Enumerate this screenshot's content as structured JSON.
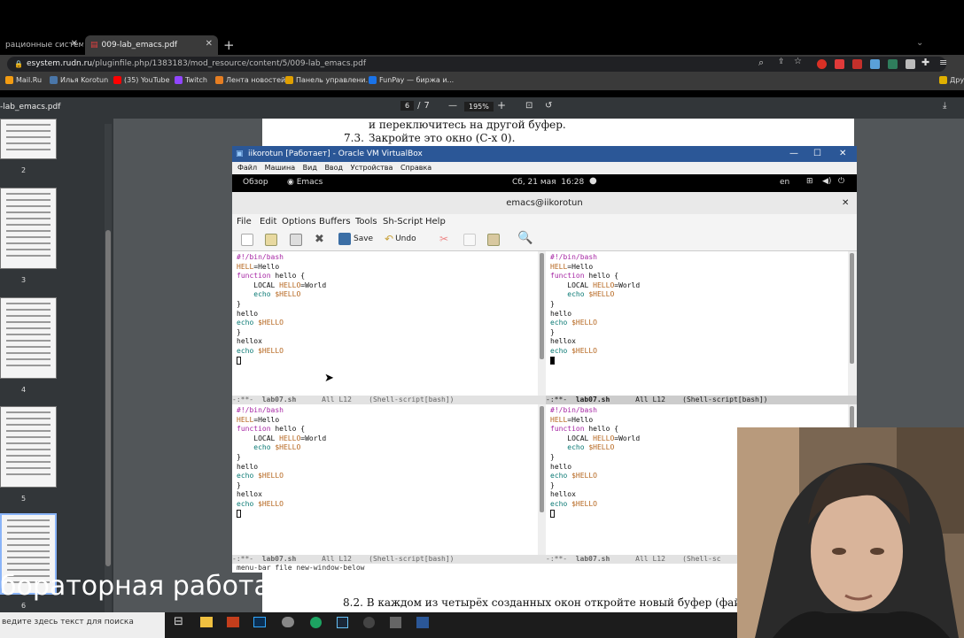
{
  "browser": {
    "tabs": [
      {
        "label": "рационные системы |"
      },
      {
        "label": "009-lab_emacs.pdf"
      }
    ],
    "url_host": "esystem.rudn.ru",
    "url_path": "/pluginfile.php/1383183/mod_resource/content/5/009-lab_emacs.pdf",
    "bookmarks": [
      "Mail.Ru",
      "Илья Korotun",
      "(35) YouTube",
      "Twitch",
      "Лента новостей",
      "Панель управлени...",
      "FunPay — биржа и...",
      "Дру"
    ]
  },
  "pdf": {
    "title": "-lab_emacs.pdf",
    "page_current": "6",
    "page_sep": "/",
    "page_total": "7",
    "zoom_out": "—",
    "zoom_in": "+",
    "zoom": "195%",
    "thumb_numbers": [
      "2",
      "3",
      "4",
      "5",
      "6"
    ],
    "text_top1": "и переключитесь на другой буфер.",
    "text_num1": "7.3.",
    "text_line1": "Закройте это окно (C-x 0).",
    "text_bottom": "8.2.  В каждом из четырёх созданных окон откройте новый буфер (файл) и"
  },
  "vm": {
    "title": "iikorotun [Работает] - Oracle VM VirtualBox",
    "menu": [
      "Файл",
      "Машина",
      "Вид",
      "Ввод",
      "Устройства",
      "Справка"
    ],
    "gnome_overview": "Обзор",
    "gnome_app": "Emacs",
    "gnome_clock": "Сб, 21 мая  16:28",
    "gnome_lang": "en"
  },
  "emacs": {
    "frame_title": "emacs@iikorotun",
    "menu": [
      "File",
      "Edit",
      "Options",
      "Buffers",
      "Tools",
      "Sh-Script",
      "Help"
    ],
    "save_label": "Save",
    "undo_label": "Undo",
    "modeline": {
      "status": "-:**-",
      "buffer": "lab07.sh",
      "position": "All L12",
      "mode": "(Shell-script[bash])",
      "mode_cut": "(Shell-sc"
    },
    "echo": "menu-bar file new-window-below",
    "code": [
      [
        [
          "#!/bin/bash",
          "k"
        ]
      ],
      [
        [
          "HELL",
          "v"
        ],
        [
          "=Hello",
          ""
        ]
      ],
      [
        [
          "function ",
          "k"
        ],
        [
          "hello {",
          ""
        ]
      ],
      [
        [
          "    LOCAL ",
          ""
        ],
        [
          "HELLO",
          "v"
        ],
        [
          "=World",
          ""
        ]
      ],
      [
        [
          "    echo ",
          "c"
        ],
        [
          "$HELLO",
          "v"
        ]
      ],
      [
        [
          "}",
          ""
        ]
      ],
      [
        [
          "hello",
          ""
        ]
      ],
      [
        [
          "echo ",
          "c"
        ],
        [
          "$HELLO",
          "v"
        ]
      ],
      [
        [
          "}",
          ""
        ]
      ],
      [
        [
          "hellox",
          ""
        ]
      ],
      [
        [
          "echo ",
          "c"
        ],
        [
          "$HELLO",
          "v"
        ]
      ]
    ]
  },
  "overlay": {
    "caption": "бораторная работа 9",
    "search_hint": "ведите здесь текст для поиска"
  }
}
